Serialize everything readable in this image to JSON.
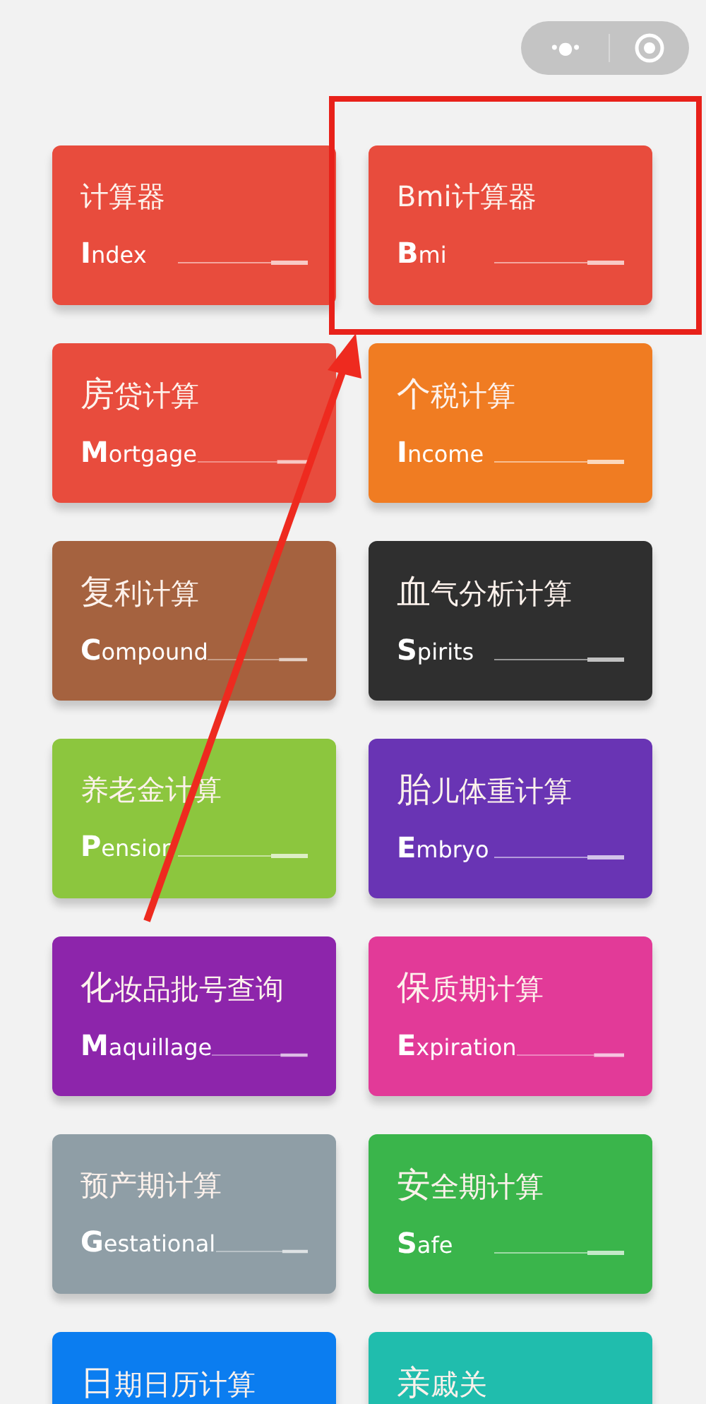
{
  "capsule": {
    "more": "•●•"
  },
  "cards": [
    {
      "title": "计算器",
      "subtitle": "Index",
      "color": "#e84c3d",
      "big_initial": false
    },
    {
      "title": "Bmi计算器",
      "subtitle": "Bmi",
      "color": "#e84c3d",
      "big_initial": false
    },
    {
      "title": "房贷计算",
      "subtitle": "Mortgage",
      "color": "#e84c3d",
      "big_initial": true
    },
    {
      "title": "个税计算",
      "subtitle": "Income",
      "color": "#f07c22",
      "big_initial": true
    },
    {
      "title": "复利计算",
      "subtitle": "Compound",
      "color": "#a5623f",
      "big_initial": true
    },
    {
      "title": "血气分析计算",
      "subtitle": "Spirits",
      "color": "#2f2f2f",
      "big_initial": true
    },
    {
      "title": "养老金计算",
      "subtitle": "Pension",
      "color": "#8cc63e",
      "big_initial": false
    },
    {
      "title": "胎儿体重计算",
      "subtitle": "Embryo",
      "color": "#6934b4",
      "big_initial": true
    },
    {
      "title": "化妆品批号查询",
      "subtitle": "Maquillage",
      "color": "#8d25ab",
      "big_initial": true
    },
    {
      "title": "保质期计算",
      "subtitle": "Expiration",
      "color": "#e23a98",
      "big_initial": true
    },
    {
      "title": "预产期计算",
      "subtitle": "Gestational",
      "color": "#8f9ea6",
      "big_initial": false
    },
    {
      "title": "安全期计算",
      "subtitle": "Safe",
      "color": "#3ab54b",
      "big_initial": true
    },
    {
      "title": "日期日历计算",
      "color": "#0b7df0",
      "big_initial": true
    },
    {
      "title": "亲戚关",
      "color": "#20bdad",
      "big_initial": true
    }
  ]
}
